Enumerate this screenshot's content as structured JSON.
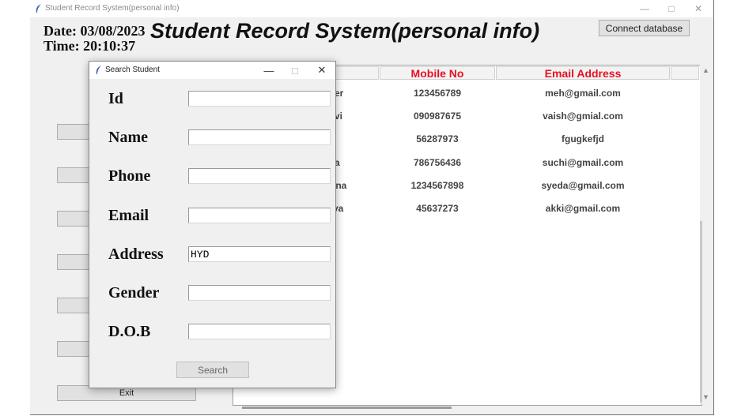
{
  "main_window": {
    "title": "Student Record System(personal info)",
    "controls": {
      "minimize": "—",
      "maximize": "□",
      "close": "✕"
    }
  },
  "header": {
    "date_text": "Date: 03/08/2023",
    "time_text": "Time: 20:10:37",
    "heading": "Student Record System(personal info)",
    "connect_button": "Connect database"
  },
  "sidebar": {
    "buttons": [
      "",
      "",
      "",
      "",
      "",
      ""
    ],
    "exit_label": "Exit"
  },
  "table": {
    "columns": [
      "Mobile No",
      "Email Address"
    ],
    "rows": [
      {
        "name_fragment": "er",
        "mobile": "123456789",
        "email": "meh@gmail.com"
      },
      {
        "name_fragment": "vi",
        "mobile": "090987675",
        "email": "vaish@gmial.com"
      },
      {
        "name_fragment": "",
        "mobile": "56287973",
        "email": "fgugkefjd"
      },
      {
        "name_fragment": "a",
        "mobile": "786756436",
        "email": "suchi@gmail.com"
      },
      {
        "name_fragment": "ona",
        "mobile": "1234567898",
        "email": "syeda@gmail.com"
      },
      {
        "name_fragment": "ya",
        "mobile": "45637273",
        "email": "akki@gmail.com"
      }
    ]
  },
  "dialog": {
    "title": "Search Student",
    "controls": {
      "minimize": "—",
      "maximize": "□",
      "close": "✕"
    },
    "fields": [
      {
        "label": "Id",
        "value": ""
      },
      {
        "label": "Name",
        "value": ""
      },
      {
        "label": "Phone",
        "value": ""
      },
      {
        "label": "Email",
        "value": ""
      },
      {
        "label": "Address",
        "value": "HYD"
      },
      {
        "label": "Gender",
        "value": ""
      },
      {
        "label": "D.O.B",
        "value": ""
      }
    ],
    "search_button": "Search"
  },
  "icons": {
    "app": "feather-icon"
  },
  "colors": {
    "column_header_text": "#e81123"
  }
}
